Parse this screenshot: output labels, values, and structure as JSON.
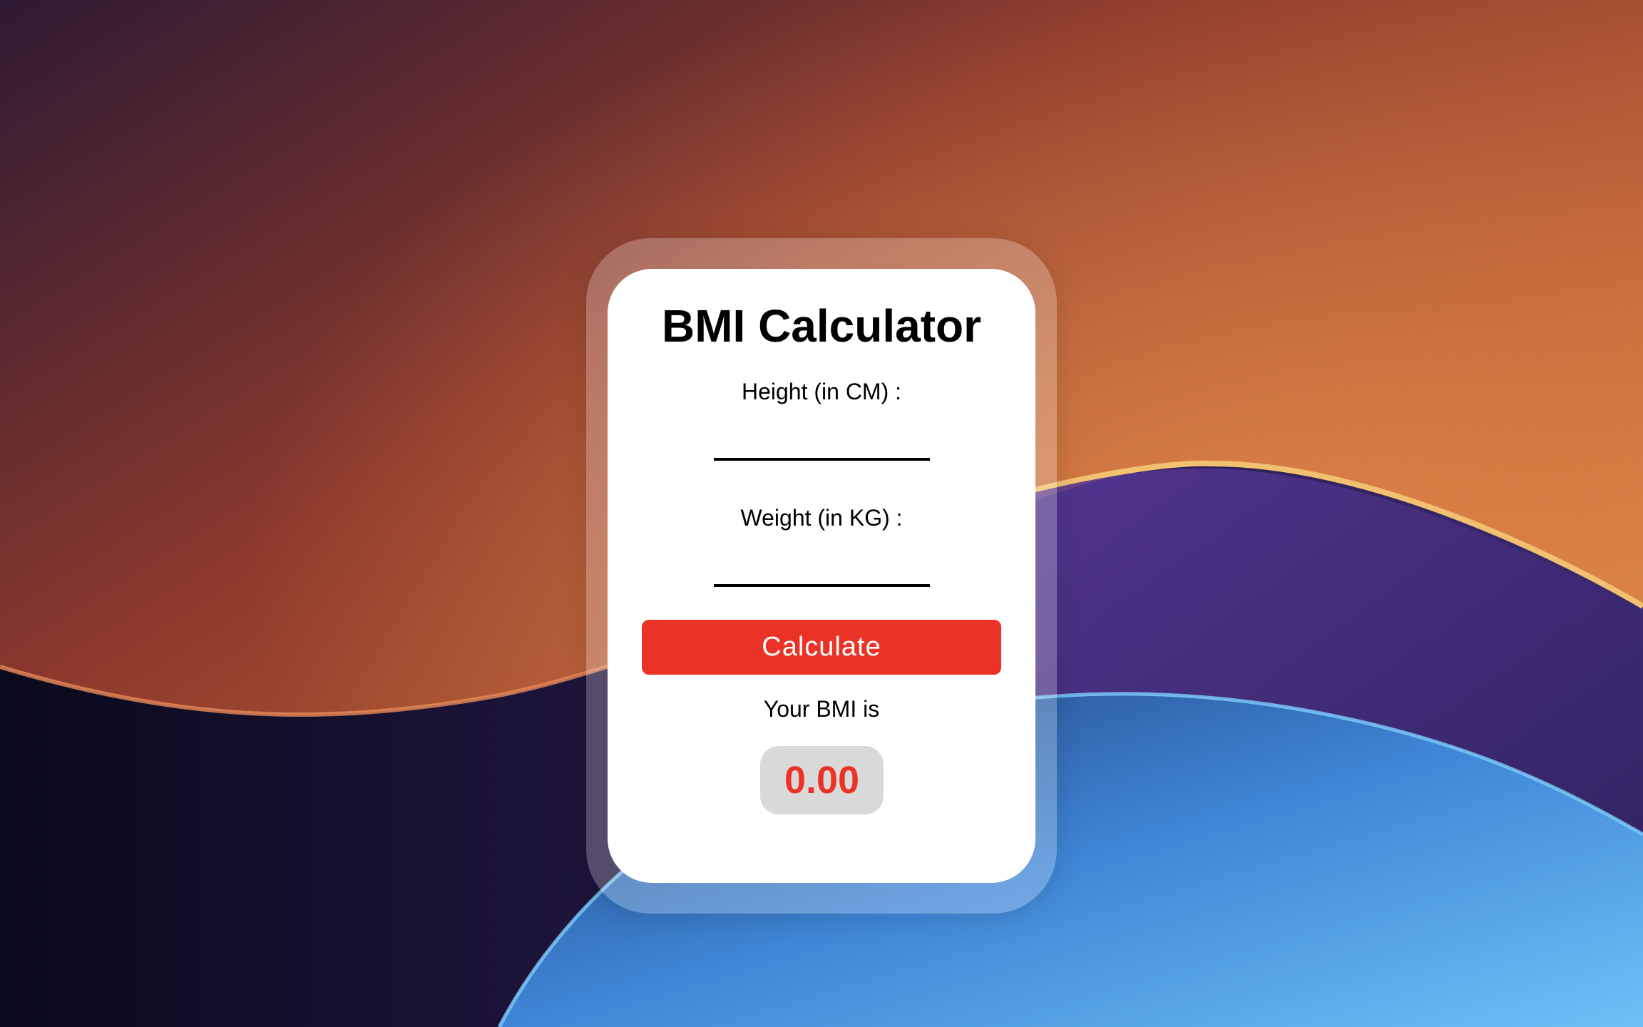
{
  "app": {
    "title": "BMI Calculator"
  },
  "form": {
    "height_label": "Height (in CM) :",
    "height_value": "",
    "weight_label": "Weight (in KG) :",
    "weight_value": "",
    "calculate_label": "Calculate"
  },
  "result": {
    "label": "Your BMI is",
    "value": "0.00"
  },
  "colors": {
    "accent": "#ea3326",
    "card": "#ffffff",
    "result_bg": "#d9d9d9"
  }
}
